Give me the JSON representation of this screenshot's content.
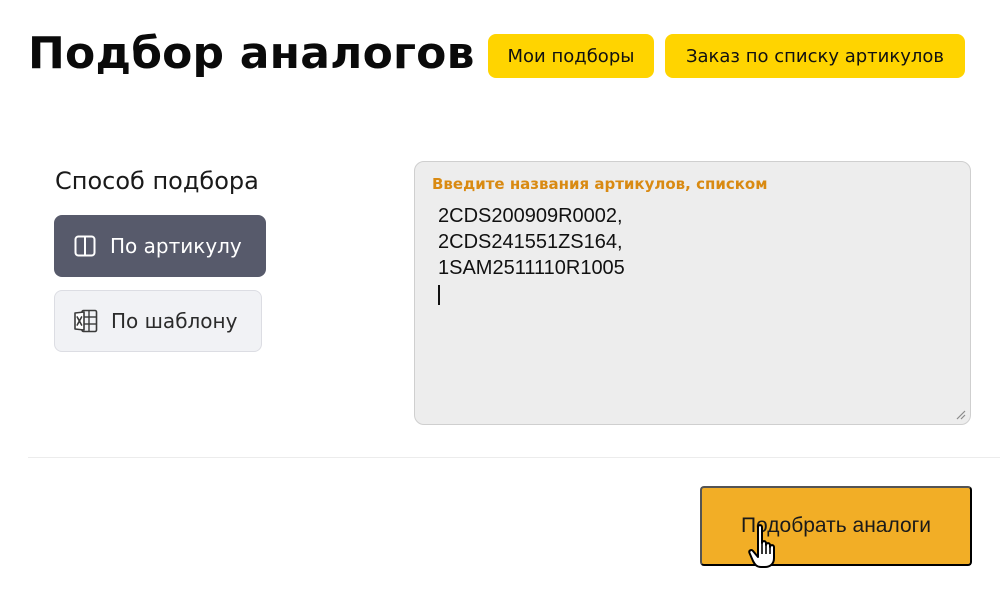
{
  "header": {
    "title": "Подбор аналогов",
    "my_selections_label": "Мои подборы",
    "order_by_list_label": "Заказ по списку артикулов"
  },
  "method": {
    "title": "Способ подбора",
    "options": [
      {
        "label": "По артикулу",
        "icon": "panel-icon",
        "active": true
      },
      {
        "label": "По шаблону",
        "icon": "excel-icon",
        "active": false
      }
    ]
  },
  "article_input": {
    "label": "Введите названия артикулов, списком",
    "value": "2CDS200909R0002,\n2CDS241551ZS164,\n1SAM2511110R1005"
  },
  "submit": {
    "label": "Подобрать аналоги"
  },
  "colors": {
    "accent_yellow": "#ffd400",
    "submit_orange": "#f2ae26",
    "active_method": "#575a6b",
    "label_orange": "#d98a12"
  }
}
